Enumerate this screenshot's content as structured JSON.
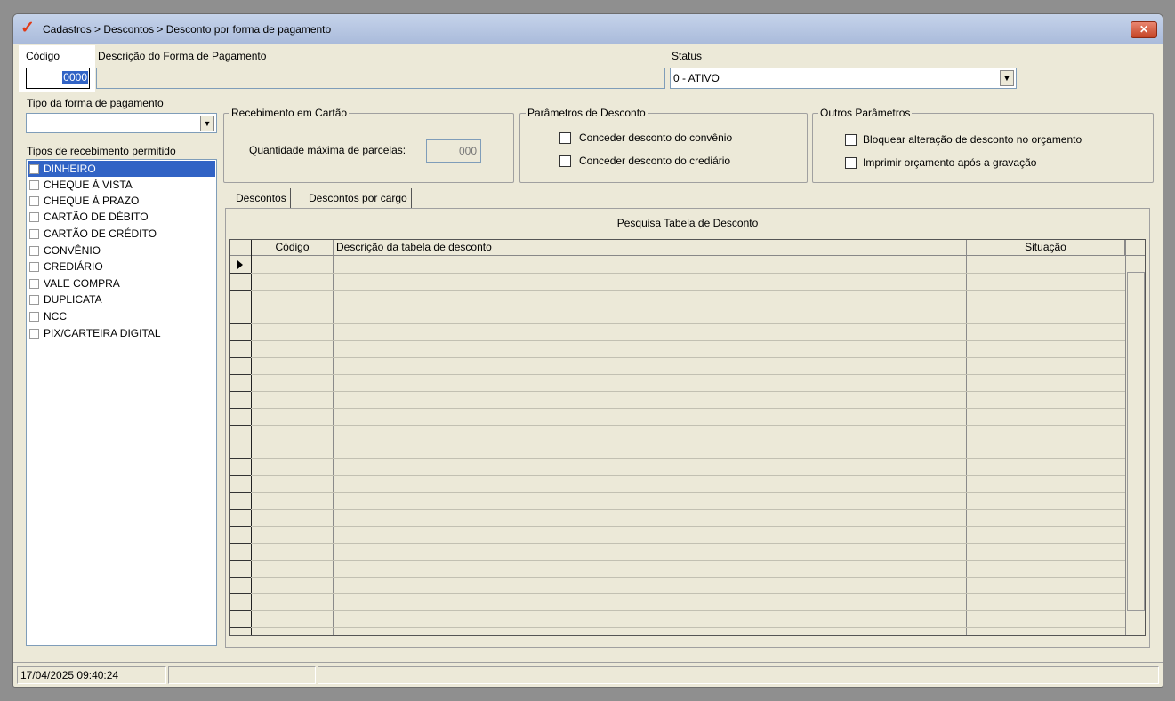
{
  "window": {
    "title": "Cadastros > Descontos > Desconto por forma de pagamento",
    "close_label": "✕"
  },
  "form": {
    "codigo_label": "Código",
    "codigo_value": "0000",
    "descricao_label": "Descrição do Forma de Pagamento",
    "descricao_value": "",
    "status_label": "Status",
    "status_value": "0 - ATIVO",
    "tipo_label": "Tipo da forma de pagamento",
    "tipo_value": "",
    "tipos_receb_label": "Tipos de recebimento permitido"
  },
  "receb_tipos": [
    {
      "label": "DINHEIRO",
      "selected": true
    },
    {
      "label": "CHEQUE À VISTA"
    },
    {
      "label": "CHEQUE À PRAZO"
    },
    {
      "label": "CARTÃO DE DÉBITO"
    },
    {
      "label": "CARTÃO DE CRÉDITO"
    },
    {
      "label": "CONVÊNIO"
    },
    {
      "label": "CREDIÁRIO"
    },
    {
      "label": "VALE COMPRA"
    },
    {
      "label": "DUPLICATA"
    },
    {
      "label": "NCC"
    },
    {
      "label": "PIX/CARTEIRA DIGITAL"
    }
  ],
  "recebimento_cartao": {
    "title": "Recebimento em Cartão",
    "qtd_label": "Quantidade máxima de parcelas:",
    "qtd_value": "000"
  },
  "parametros_desconto": {
    "title": "Parâmetros de Desconto",
    "opt1": "Conceder desconto do convênio",
    "opt2": "Conceder desconto do crediário"
  },
  "outros_parametros": {
    "title": "Outros Parâmetros",
    "opt1": "Bloquear alteração de desconto no orçamento",
    "opt2": "Imprimir orçamento após a gravação"
  },
  "tabs": {
    "t1": "Descontos",
    "t2": "Descontos por cargo"
  },
  "grid": {
    "title": "Pesquisa Tabela de Desconto",
    "col_codigo": "Código",
    "col_descricao": "Descrição da tabela de desconto",
    "col_situacao": "Situação"
  },
  "statusbar": {
    "datetime": "17/04/2025 09:40:24"
  }
}
